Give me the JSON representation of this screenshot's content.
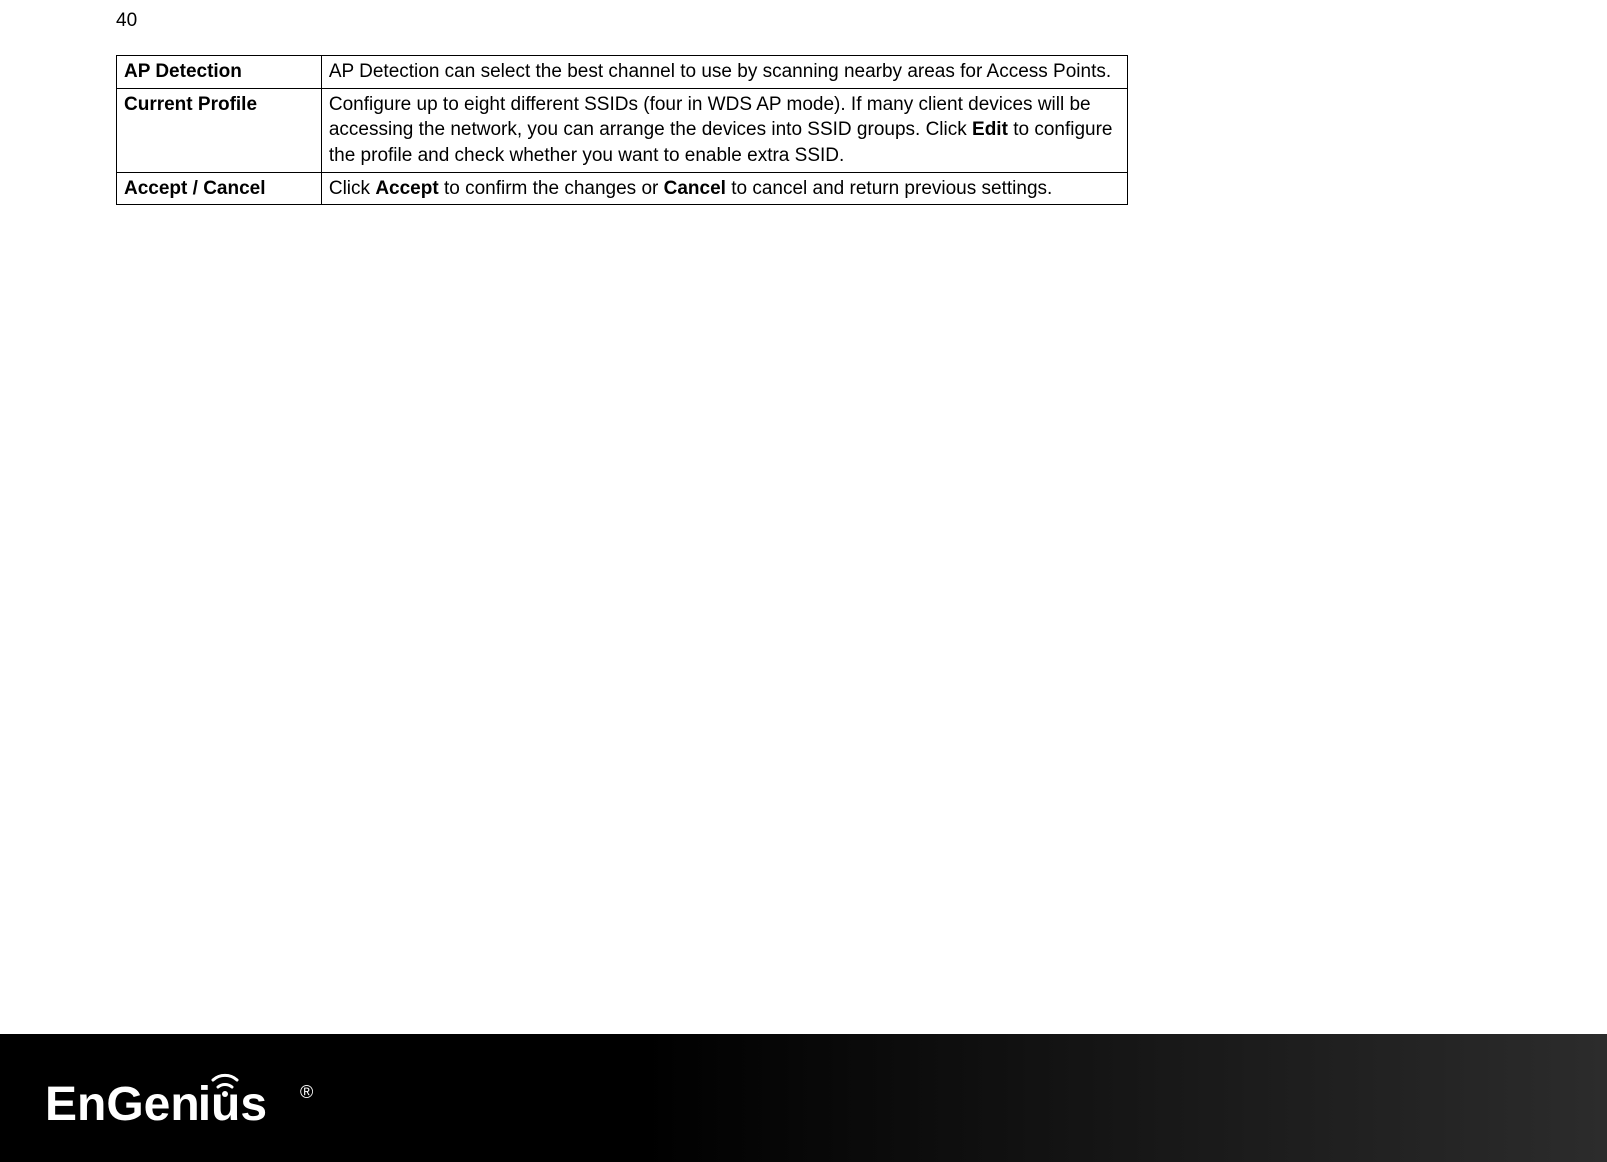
{
  "page": {
    "number": "40"
  },
  "table": {
    "rows": [
      {
        "term": "AP Detection",
        "desc_parts": [
          {
            "bold": false,
            "text": "AP Detection can select the best channel to use by scanning nearby areas for Access Points."
          }
        ]
      },
      {
        "term": "Current Profile",
        "desc_parts": [
          {
            "bold": false,
            "text": "Configure up to eight different SSIDs (four in WDS AP mode). If many client devices will be accessing the network, you can arrange the devices into SSID groups. Click "
          },
          {
            "bold": true,
            "text": "Edit"
          },
          {
            "bold": false,
            "text": " to configure the profile and check whether you want to enable extra SSID."
          }
        ]
      },
      {
        "term": "Accept / Cancel",
        "desc_parts": [
          {
            "bold": false,
            "text": "Click "
          },
          {
            "bold": true,
            "text": "Accept"
          },
          {
            "bold": false,
            "text": " to confirm the changes or "
          },
          {
            "bold": true,
            "text": "Cancel"
          },
          {
            "bold": false,
            "text": " to cancel and return previous settings."
          }
        ]
      }
    ]
  },
  "footer": {
    "brand": "EnGenius",
    "trademark": "®"
  }
}
